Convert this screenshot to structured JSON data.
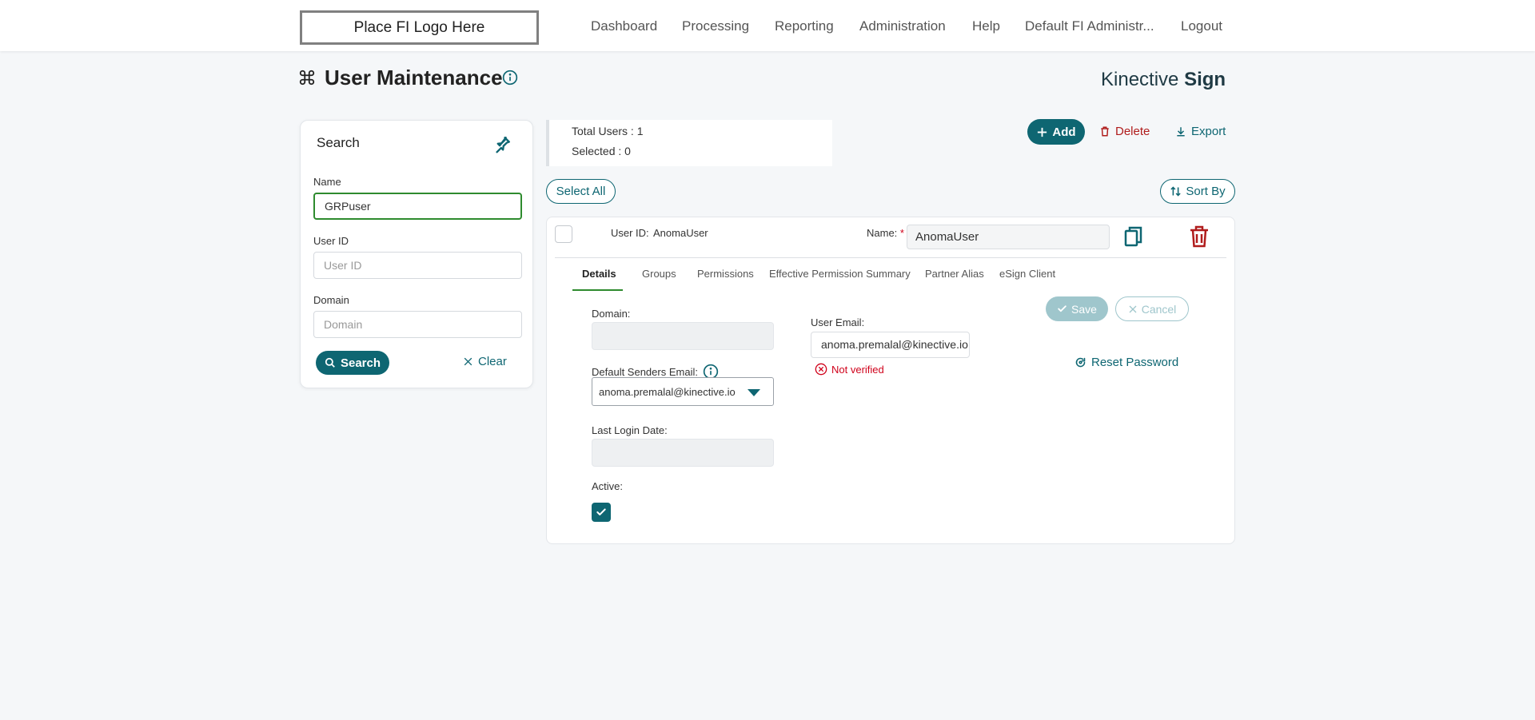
{
  "header": {
    "logo_text": "Place FI Logo Here",
    "nav": [
      "Dashboard",
      "Processing",
      "Reporting",
      "Administration",
      "Help",
      "Default FI Administr...",
      "Logout"
    ]
  },
  "page": {
    "title": "User Maintenance",
    "brand_light": "Kinective",
    "brand_bold": "Sign"
  },
  "search": {
    "title": "Search",
    "name_label": "Name",
    "name_value": "GRPuser",
    "userid_label": "User ID",
    "userid_placeholder": "User ID",
    "domain_label": "Domain",
    "domain_placeholder": "Domain",
    "search_button": "Search",
    "clear_button": "Clear"
  },
  "summary": {
    "total_users": "Total Users : 1",
    "selected": "Selected : 0"
  },
  "actions": {
    "add": "Add",
    "delete": "Delete",
    "export": "Export",
    "select_all": "Select All",
    "sort_by": "Sort By"
  },
  "user": {
    "userid_label": "User ID:",
    "userid_value": "AnomaUser",
    "name_label": "Name:",
    "name_required": "*",
    "name_value": "AnomaUser",
    "tabs": [
      "Details",
      "Groups",
      "Permissions",
      "Effective Permission Summary",
      "Partner Alias",
      "eSign Client"
    ],
    "active_tab": "Details",
    "details": {
      "domain_label": "Domain:",
      "domain_value": "",
      "default_senders_email_label": "Default Senders Email:",
      "default_senders_email_value": "anoma.premalal@kinective.io",
      "last_login_label": "Last Login Date:",
      "last_login_value": "",
      "active_label": "Active:",
      "active_checked": true,
      "user_email_label": "User Email:",
      "user_email_value": "anoma.premalal@kinective.io",
      "not_verified": "Not verified",
      "save": "Save",
      "cancel": "Cancel",
      "reset_password": "Reset Password"
    }
  },
  "colors": {
    "primary": "#0e6672",
    "danger": "#b01c1c",
    "active_green": "#2e8b2e",
    "background": "#f5f7f9"
  }
}
